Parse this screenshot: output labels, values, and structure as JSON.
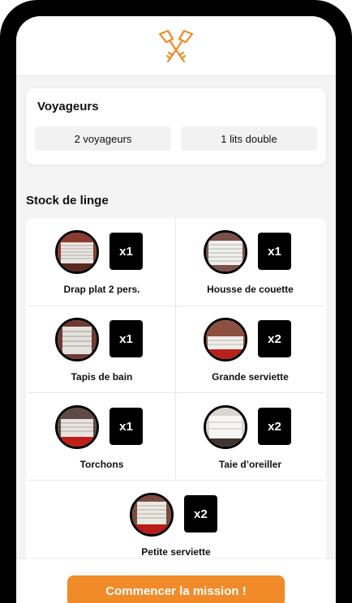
{
  "brand": {
    "logo_icon": "crossed-keys-icon",
    "accent": "#f18a28"
  },
  "travelers": {
    "title": "Voyageurs",
    "guests": "2 voyageurs",
    "beds": "1 lits double"
  },
  "linen": {
    "title": "Stock de linge",
    "items": [
      {
        "name": "Drap plat 2 pers.",
        "qty": "x1"
      },
      {
        "name": "Housse de couette",
        "qty": "x1"
      },
      {
        "name": "Tapis de bain",
        "qty": "x1"
      },
      {
        "name": "Grande serviette",
        "qty": "x2"
      },
      {
        "name": "Torchons",
        "qty": "x1"
      },
      {
        "name": "Taie d’oreiller",
        "qty": "x2"
      },
      {
        "name": "Petite serviette",
        "qty": "x2"
      }
    ]
  },
  "actions": {
    "start_mission": "Commencer la mission !"
  }
}
